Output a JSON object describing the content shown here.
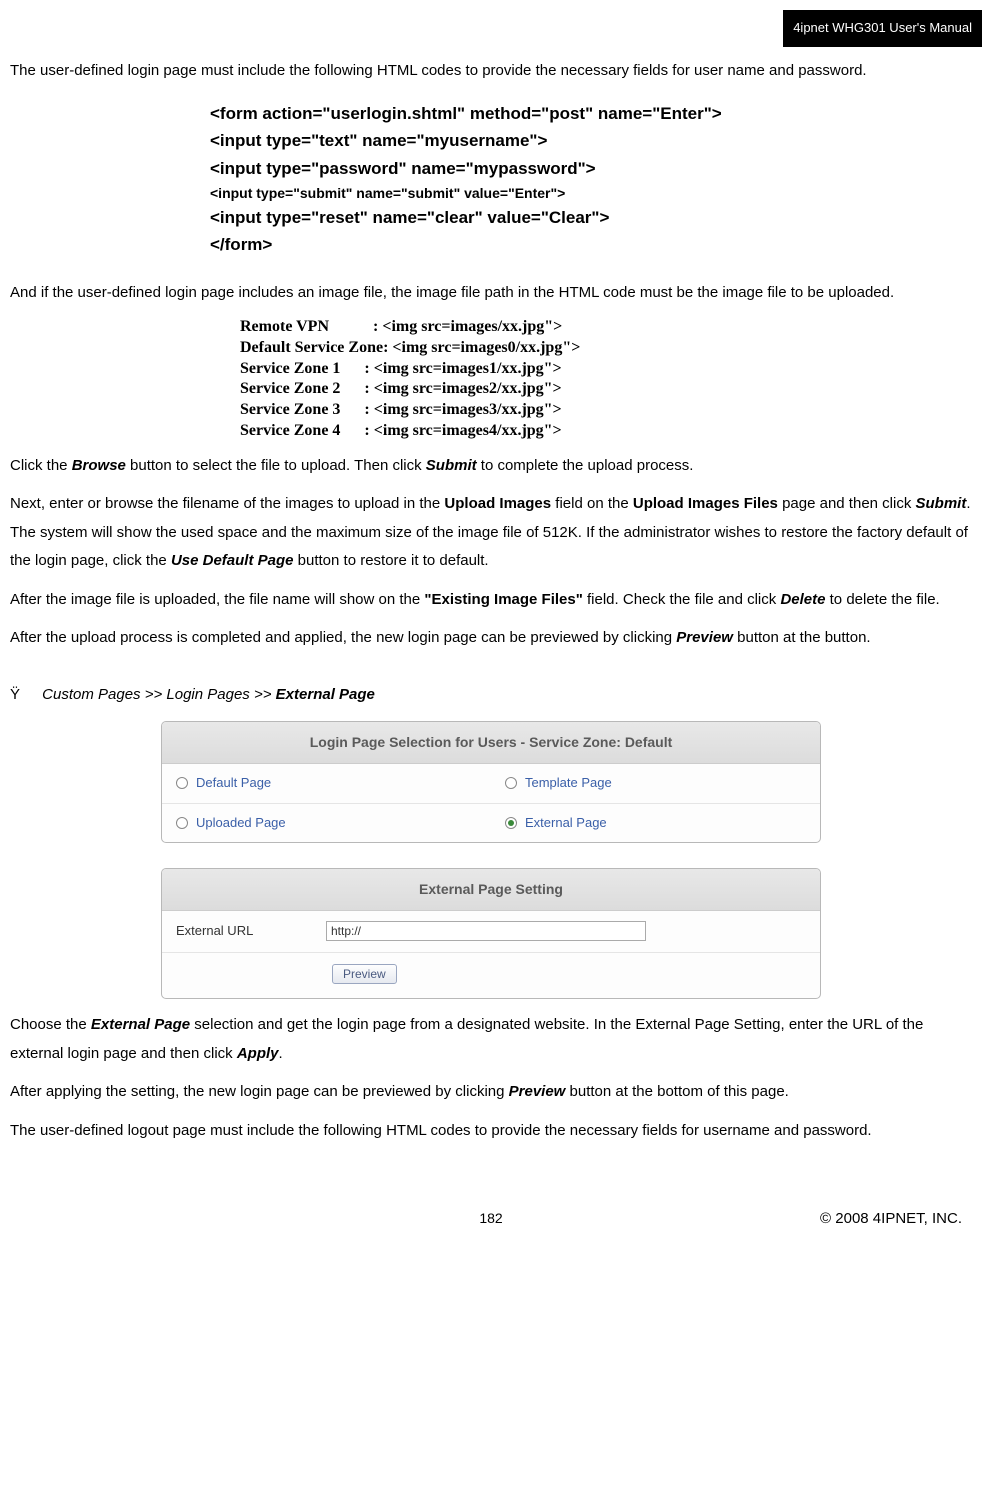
{
  "header": {
    "title": "4ipnet WHG301 User's Manual"
  },
  "para1": "The user-defined login page must include the following HTML codes to provide the necessary fields for user name and password.",
  "code": {
    "l1": "<form action=\"userlogin.shtml\" method=\"post\" name=\"Enter\">",
    "l2": "<input type=\"text\" name=\"myusername\">",
    "l3": "<input type=\"password\" name=\"mypassword\">",
    "l4": "<input type=\"submit\" name=\"submit\" value=\"Enter\">",
    "l5": "<input type=\"reset\" name=\"clear\" value=\"Clear\">",
    "l6": "</form>"
  },
  "para2": "And if the user-defined login page includes an image file, the image file path in the HTML code must be the image file to be uploaded.",
  "zones": {
    "z1": {
      "label": "Remote VPN",
      "sep": ":",
      "val": "<img src=images/xx.jpg\">"
    },
    "z2": {
      "label": "Default Service Zone:",
      "val": "<img src=images0/xx.jpg\">"
    },
    "z3": {
      "label": "Service Zone 1",
      "sep": ":",
      "val": "<img src=images1/xx.jpg\">"
    },
    "z4": {
      "label": "Service Zone 2",
      "sep": ":",
      "val": "<img src=images2/xx.jpg\">"
    },
    "z5": {
      "label": "Service Zone 3",
      "sep": ":",
      "val": "<img src=images3/xx.jpg\">"
    },
    "z6": {
      "label": "Service Zone 4",
      "sep": ":",
      "val": "<img src=images4/xx.jpg\">"
    }
  },
  "p3": {
    "t1": "Click the ",
    "b1": "Browse",
    "t2": " button to select the file to upload. Then click ",
    "b2": "Submit",
    "t3": " to complete the upload process."
  },
  "p4": {
    "t1": "Next, enter or browse the filename of the images to upload in the ",
    "b1": "Upload Images",
    "t2": " field on the ",
    "b2": "Upload Images Files",
    "t3": " page and then click ",
    "b3": "Submit",
    "t4": ". The system will show the used space and the maximum size of the image file of 512K. If the administrator wishes to restore the factory default of the login page, click the ",
    "b4": "Use Default Page",
    "t5": " button to restore it to default."
  },
  "p5": {
    "t1": "After the image file is uploaded, the file name will show on the ",
    "b1": "\"Existing Image Files\"",
    "t2": " field. Check the file and click ",
    "b2": "Delete",
    "t3": " to delete the file."
  },
  "p6": {
    "t1": "After the upload process is completed and applied, the new login page can be previewed by clicking ",
    "b1": "Preview",
    "t2": " button at the button."
  },
  "bullet": {
    "sym": "Ÿ",
    "t1": "Custom Pages >> Login Pages >> ",
    "b1": "External Page"
  },
  "panel1": {
    "header": "Login Page Selection for Users - Service Zone: Default",
    "o1": "Default Page",
    "o2": "Template Page",
    "o3": "Uploaded Page",
    "o4": "External Page"
  },
  "panel2": {
    "header": "External Page Setting",
    "label": "External URL",
    "value": "http://",
    "btn": "Preview"
  },
  "p7": {
    "t1": "Choose the ",
    "b1": "External Page",
    "t2": " selection and get the login page from a designated website. In the External Page Setting, enter the URL of the external login page and then click ",
    "b2": "Apply",
    "t3": "."
  },
  "p8": {
    "t1": "After applying the setting, the new login page can be previewed by clicking ",
    "b1": "Preview",
    "t2": " button at the bottom of this page."
  },
  "p9": "The user-defined logout page must include the following HTML codes to provide the necessary fields for username and password.",
  "footer": {
    "page": "182",
    "copy": "© 2008 4IPNET, INC."
  }
}
